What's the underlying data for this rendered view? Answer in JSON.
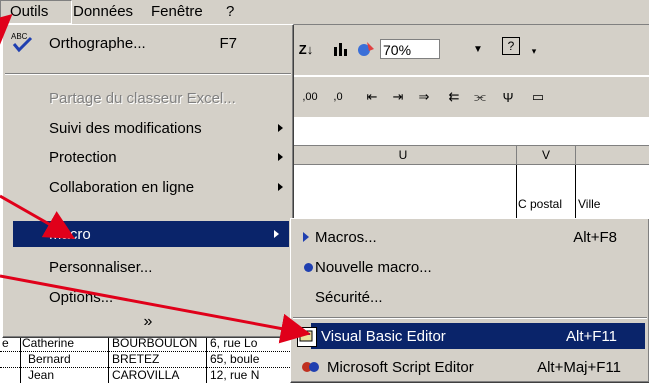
{
  "menubar": {
    "items": [
      {
        "label": "Outils"
      },
      {
        "label": "Données"
      },
      {
        "label": "Fenêtre"
      },
      {
        "label": "?"
      }
    ]
  },
  "toolbar": {
    "zoom": "70%"
  },
  "sheet": {
    "column_u": "U",
    "column_v": "V",
    "header_cp": "C postal",
    "header_ville": "Ville",
    "rows": [
      [
        "e",
        "Catherine",
        "BOURBOULON",
        "6, rue Lo"
      ],
      [
        "",
        "Bernard",
        "BRETEZ",
        "65, boule"
      ],
      [
        "",
        "Jean",
        "CAROVILLA",
        "12, rue N"
      ]
    ]
  },
  "outils_menu": {
    "items": [
      {
        "label": "Orthographe...",
        "shortcut": "F7",
        "icon": "spellcheck-icon"
      },
      {
        "label": "Partage du classeur Excel...",
        "disabled": true
      },
      {
        "label": "Suivi des modifications",
        "submenu": true
      },
      {
        "label": "Protection",
        "submenu": true
      },
      {
        "label": "Collaboration en ligne",
        "submenu": true
      },
      {
        "label": "Macro",
        "submenu": true,
        "selected": true
      },
      {
        "label": "Personnaliser..."
      },
      {
        "label": "Options..."
      }
    ],
    "expand": "»"
  },
  "macro_menu": {
    "items": [
      {
        "label": "Macros...",
        "shortcut": "Alt+F8",
        "icon": "play-icon"
      },
      {
        "label": "Nouvelle macro...",
        "icon": "record-icon"
      },
      {
        "label": "Sécurité..."
      },
      {
        "label": "Visual Basic Editor",
        "shortcut": "Alt+F11",
        "icon": "vb-editor-icon",
        "selected": true
      },
      {
        "label": "Microsoft Script Editor",
        "shortcut": "Alt+Maj+F11",
        "icon": "script-editor-icon"
      }
    ]
  },
  "colors": {
    "highlight": "#0a246a",
    "menu_bg": "#d4d0c8",
    "arrow": "#e0001a"
  }
}
